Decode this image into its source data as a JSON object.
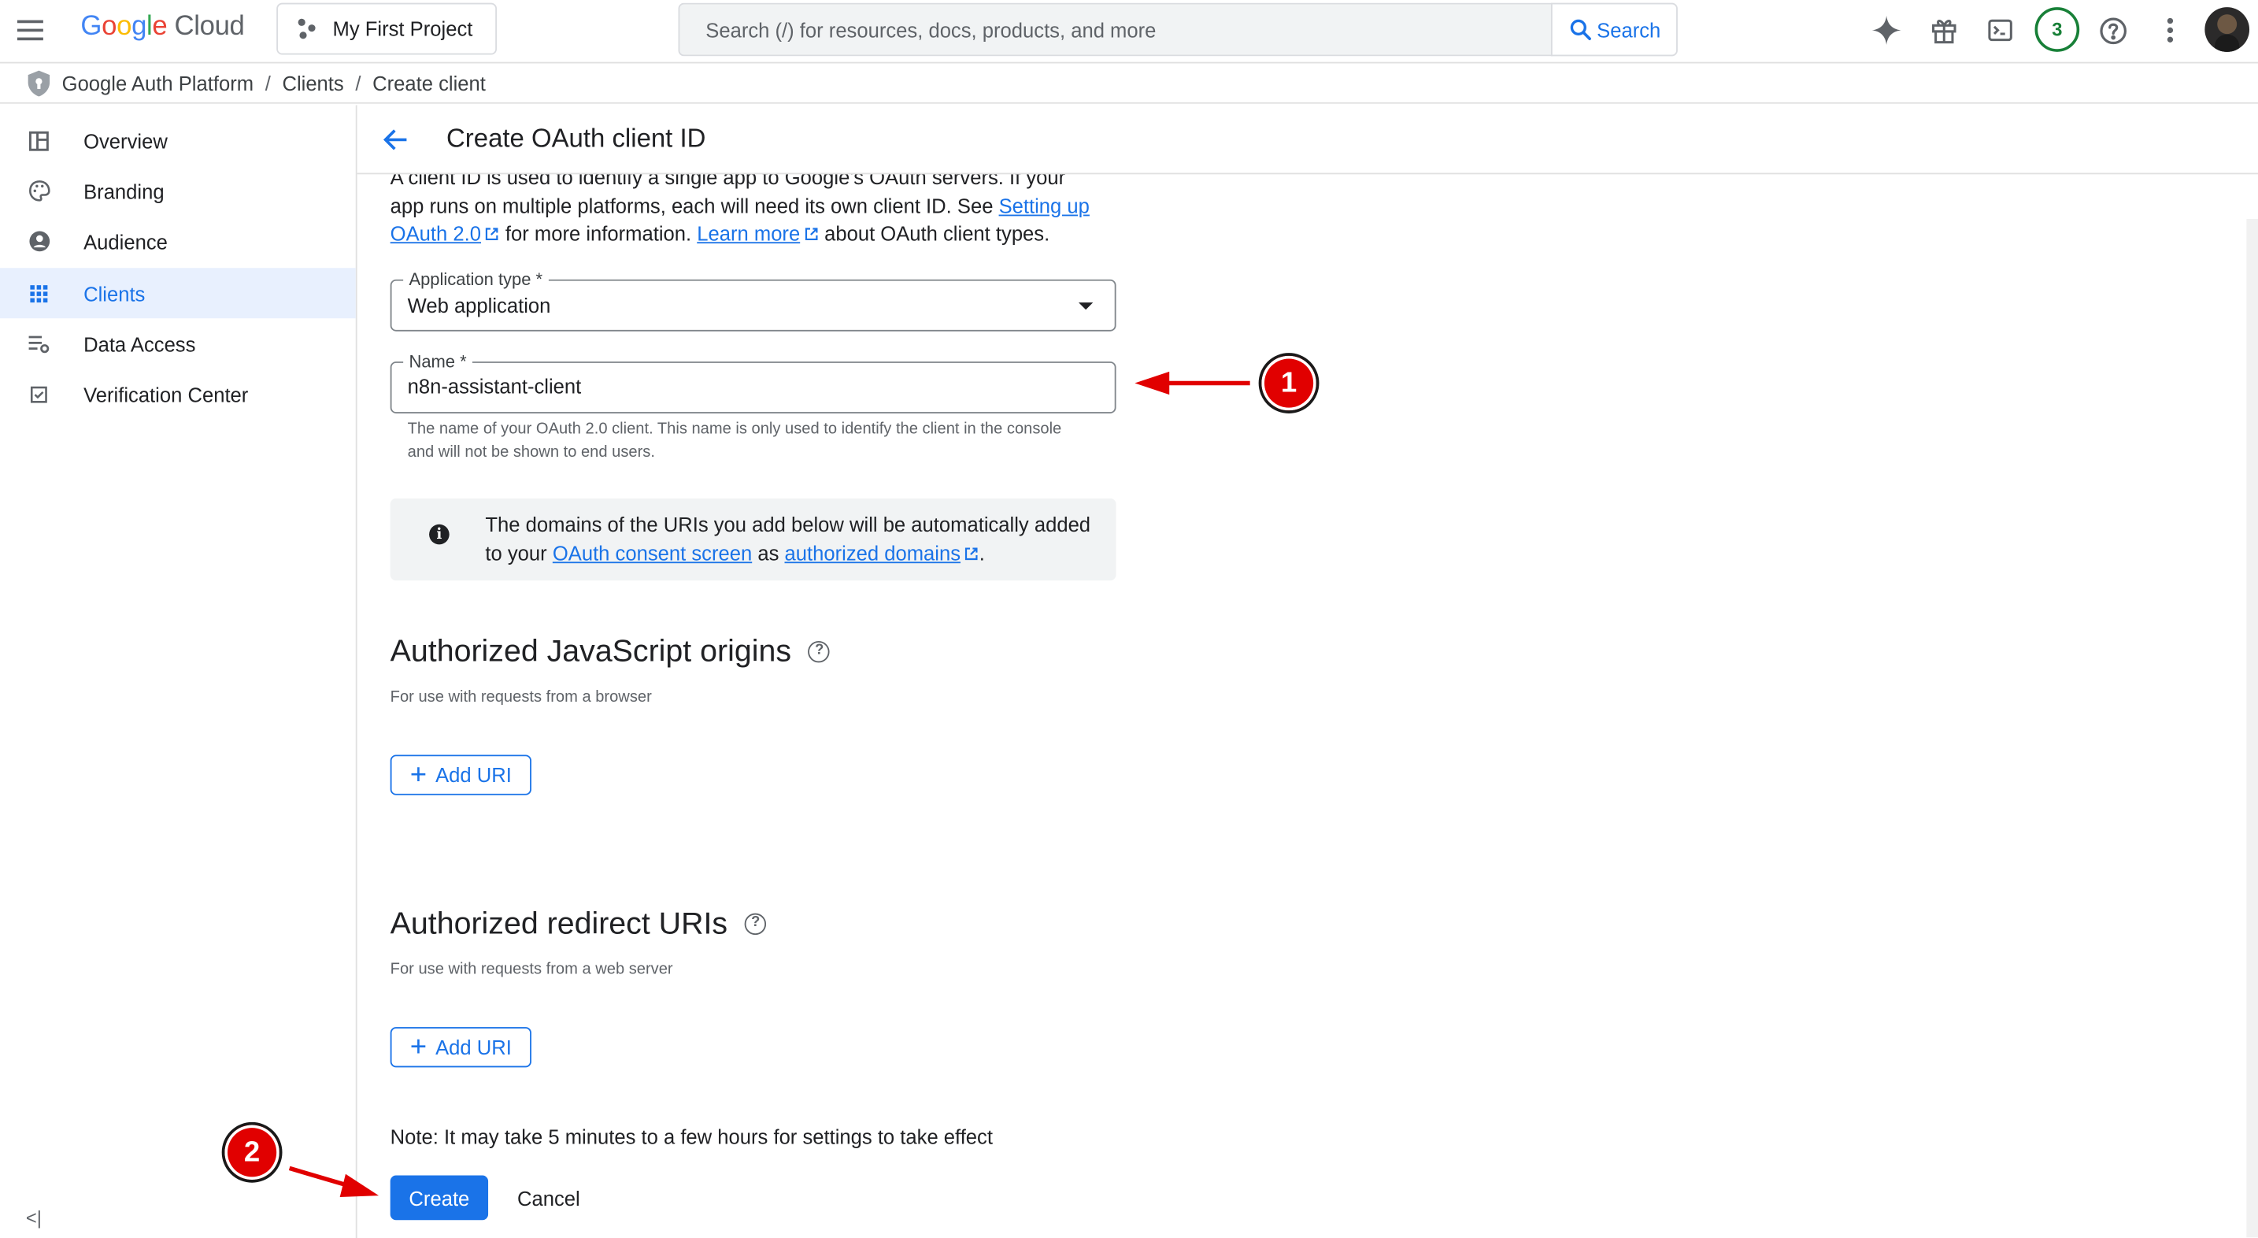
{
  "header": {
    "brand_google": "Google",
    "brand_cloud": "Cloud",
    "project_label": "My First Project",
    "search_placeholder": "Search (/) for resources, docs, products, and more",
    "search_button": "Search",
    "notification_count": "3",
    "icons": [
      "menu-icon",
      "gemini-spark-icon",
      "gift-icon",
      "cloud-shell-icon",
      "help-icon",
      "more-vert-icon"
    ]
  },
  "breadcrumb": {
    "items": [
      "Google Auth Platform",
      "Clients",
      "Create client"
    ],
    "separator": "/"
  },
  "sidebar": {
    "items": [
      {
        "label": "Overview",
        "icon": "dashboard-icon"
      },
      {
        "label": "Branding",
        "icon": "palette-icon"
      },
      {
        "label": "Audience",
        "icon": "account-circle-icon"
      },
      {
        "label": "Clients",
        "icon": "apps-grid-icon",
        "active": true
      },
      {
        "label": "Data Access",
        "icon": "data-access-icon"
      },
      {
        "label": "Verification Center",
        "icon": "verified-checkbox-icon"
      }
    ],
    "collapse_label": "<|"
  },
  "main": {
    "title": "Create OAuth client ID",
    "intro_line1": "A client ID is used to identify a single app to Google's OAuth servers. If your app runs on multiple platforms, each will need its own client ID. See ",
    "intro_link1": "Setting up OAuth 2.0",
    "intro_mid": " for more information. ",
    "intro_link2": "Learn more",
    "intro_end": " about OAuth client types.",
    "app_type_label": "Application type *",
    "app_type_value": "Web application",
    "name_label": "Name *",
    "name_value": "n8n-assistant-client",
    "name_helper": "The name of your OAuth 2.0 client. This name is only used to identify the client in the console and will not be shown to end users.",
    "info_text_start": "The domains of the URIs you add below will be automatically added to your ",
    "info_link1": "OAuth consent screen",
    "info_mid": " as ",
    "info_link2": "authorized domains",
    "info_end": ".",
    "js_origins_title": "Authorized JavaScript origins",
    "js_origins_sub": "For use with requests from a browser",
    "redirect_title": "Authorized redirect URIs",
    "redirect_sub": "For use with requests from a web server",
    "add_uri_label": "Add URI",
    "note": "Note: It may take 5 minutes to a few hours for settings to take effect",
    "create_label": "Create",
    "cancel_label": "Cancel"
  },
  "annotations": {
    "callout_1": "1",
    "callout_2": "2",
    "color": "#e10000"
  }
}
